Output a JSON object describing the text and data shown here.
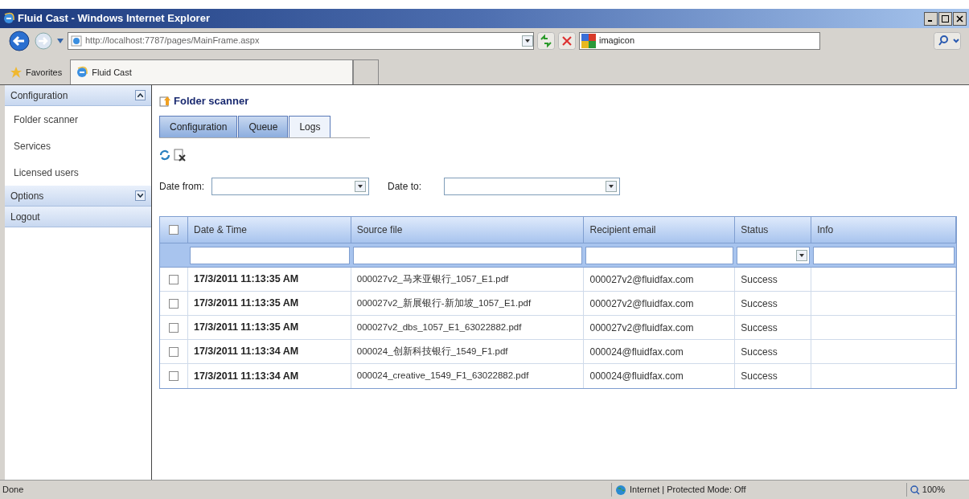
{
  "window": {
    "title": "Fluid Cast - Windows Internet Explorer"
  },
  "address_bar": {
    "url": "http://localhost:7787/pages/MainFrame.aspx"
  },
  "search_box": {
    "value": "imagicon"
  },
  "favorites_bar": {
    "favorites": "Favorites",
    "tabs": [
      {
        "label": "Fluid Cast",
        "selected": true
      }
    ]
  },
  "sidebar": {
    "sections": [
      {
        "label": "Configuration",
        "expanded": true,
        "items": [
          "Folder scanner",
          "Services",
          "Licensed users"
        ]
      },
      {
        "label": "Options",
        "expanded": false
      },
      {
        "label": "Logout"
      }
    ]
  },
  "page": {
    "title": "Folder scanner",
    "tabs": [
      {
        "label": "Configuration",
        "selected": false
      },
      {
        "label": "Queue",
        "selected": false
      },
      {
        "label": "Logs",
        "selected": true
      }
    ],
    "date_from": {
      "label": "Date from:"
    },
    "date_to": {
      "label": "Date to:"
    },
    "table": {
      "all_checked": false,
      "columns": [
        "Date & Time",
        "Source file",
        "Recipient email",
        "Status",
        "Info"
      ],
      "rows": [
        {
          "checked": false,
          "date_time": "17/3/2011 11:13:35 AM",
          "source_file": "000027v2_马来亚银行_1057_E1.pdf",
          "recipient_email": "000027v2@fluidfax.com",
          "status": "Success"
        },
        {
          "checked": false,
          "date_time": "17/3/2011 11:13:35 AM",
          "source_file": "000027v2_新展银行-新加坡_1057_E1.pdf",
          "recipient_email": "000027v2@fluidfax.com",
          "status": "Success"
        },
        {
          "checked": false,
          "date_time": "17/3/2011 11:13:35 AM",
          "source_file": "000027v2_dbs_1057_E1_63022882.pdf",
          "recipient_email": "000027v2@fluidfax.com",
          "status": "Success"
        },
        {
          "checked": false,
          "date_time": "17/3/2011 11:13:34 AM",
          "source_file": "000024_创新科技银行_1549_F1.pdf",
          "recipient_email": "000024@fluidfax.com",
          "status": "Success"
        },
        {
          "checked": false,
          "date_time": "17/3/2011 11:13:34 AM",
          "source_file": "000024_creative_1549_F1_63022882.pdf",
          "recipient_email": "000024@fluidfax.com",
          "status": "Success"
        }
      ]
    }
  },
  "status_bar": {
    "text": "Done",
    "zone": "Internet | Protected Mode: Off",
    "zoom": "100%"
  }
}
